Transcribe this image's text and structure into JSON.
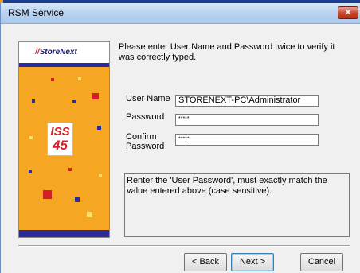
{
  "window": {
    "title": "RSM Service",
    "close_glyph": "✕"
  },
  "banner": {
    "logo_mark": "//",
    "logo_text": "StoreNext",
    "product_line1": "ISS",
    "product_line2": "45"
  },
  "form": {
    "instruction": "Please enter User Name and Password twice to verify it was correctly typed.",
    "user_name_label": "User Name",
    "user_name_value": "STORENEXT-PC\\Administrator",
    "password_label": "Password",
    "password_value": "*****",
    "confirm_label_line1": "Confirm",
    "confirm_label_line2": "Password",
    "confirm_value": "*****"
  },
  "help": {
    "text": "Renter the 'User Password', must exactly match the value entered above (case sensitive)."
  },
  "buttons": {
    "back": "< Back",
    "next": "Next >",
    "cancel": "Cancel"
  }
}
